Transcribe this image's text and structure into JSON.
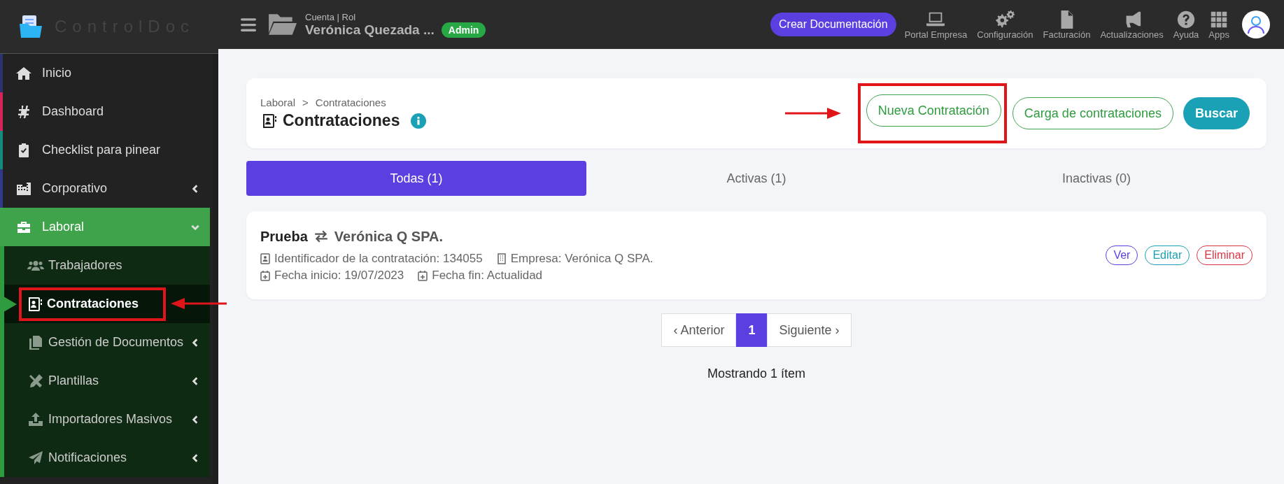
{
  "logo": {
    "text": "ControlDoc"
  },
  "topbar": {
    "account_label": "Cuenta | Rol",
    "account_name": "Verónica Quezada ...",
    "role_badge": "Admin",
    "create_button": "Crear Documentación",
    "tools": [
      {
        "kind": "laptop",
        "label": "Portal Empresa"
      },
      {
        "kind": "gears",
        "label": "Configuración"
      },
      {
        "kind": "invoice",
        "label": "Facturación"
      },
      {
        "kind": "megaphone",
        "label": "Actualizaciones"
      },
      {
        "kind": "help",
        "label": "Ayuda"
      },
      {
        "kind": "apps",
        "label": "Apps"
      }
    ]
  },
  "sidebar": {
    "items": [
      {
        "kind": "home",
        "label": "Inicio",
        "color": "#2c3170",
        "expanded": false,
        "has_caret": false
      },
      {
        "kind": "hash",
        "label": "Dashboard",
        "color": "#d6245a",
        "expanded": false,
        "has_caret": false
      },
      {
        "kind": "clipboard",
        "label": "Checklist para pinear",
        "color": "#138a7c",
        "expanded": false,
        "has_caret": false
      },
      {
        "kind": "building",
        "label": "Corporativo",
        "color": "#2f3a8c",
        "expanded": false,
        "has_caret": true
      },
      {
        "kind": "briefcase",
        "label": "Laboral",
        "expanded": true,
        "has_caret": true,
        "children": [
          {
            "kind": "users",
            "label": "Trabajadores",
            "selected": false,
            "annotated": false,
            "has_caret": false
          },
          {
            "kind": "contact",
            "label": "Contrataciones",
            "selected": true,
            "annotated": true,
            "has_caret": false
          },
          {
            "kind": "copy",
            "label": "Gestión de Documentos",
            "selected": false,
            "annotated": false,
            "has_caret": true
          },
          {
            "kind": "tools",
            "label": "Plantillas",
            "selected": false,
            "annotated": false,
            "has_caret": true
          },
          {
            "kind": "upload",
            "label": "Importadores Masivos",
            "selected": false,
            "annotated": false,
            "has_caret": true
          },
          {
            "kind": "send",
            "label": "Notificaciones",
            "selected": false,
            "annotated": false,
            "has_caret": true
          }
        ]
      }
    ]
  },
  "header": {
    "breadcrumb": [
      "Laboral",
      "Contrataciones"
    ],
    "separator": ">",
    "title": "Contrataciones",
    "actions": [
      {
        "kind": "outline",
        "label": "Nueva Contratación",
        "annotated": true
      },
      {
        "kind": "outline",
        "label": "Carga de contrataciones",
        "annotated": false
      },
      {
        "kind": "solid",
        "label": "Buscar",
        "annotated": false
      }
    ]
  },
  "tabs": [
    {
      "label": "Todas (1)",
      "selected": true
    },
    {
      "label": "Activas (1)",
      "selected": false
    },
    {
      "label": "Inactivas (0)",
      "selected": false
    }
  ],
  "records": [
    {
      "name": "Prueba",
      "company": "Verónica Q SPA.",
      "identifier": "Identificador de la contratación: 134055",
      "empresa": "Empresa: Verónica Q SPA.",
      "start": "Fecha inicio: 19/07/2023",
      "end": "Fecha fin: Actualidad",
      "actions": [
        {
          "label": "Ver",
          "color": "#5b3fe0"
        },
        {
          "label": "Editar",
          "color": "#1ba1b5"
        },
        {
          "label": "Eliminar",
          "color": "#dc3545"
        }
      ]
    }
  ],
  "pagination": {
    "prev": "‹ Anterior",
    "pages": [
      {
        "label": "1",
        "selected": true
      }
    ],
    "next": "Siguiente ›"
  },
  "footer_text": "Mostrando 1 ítem"
}
